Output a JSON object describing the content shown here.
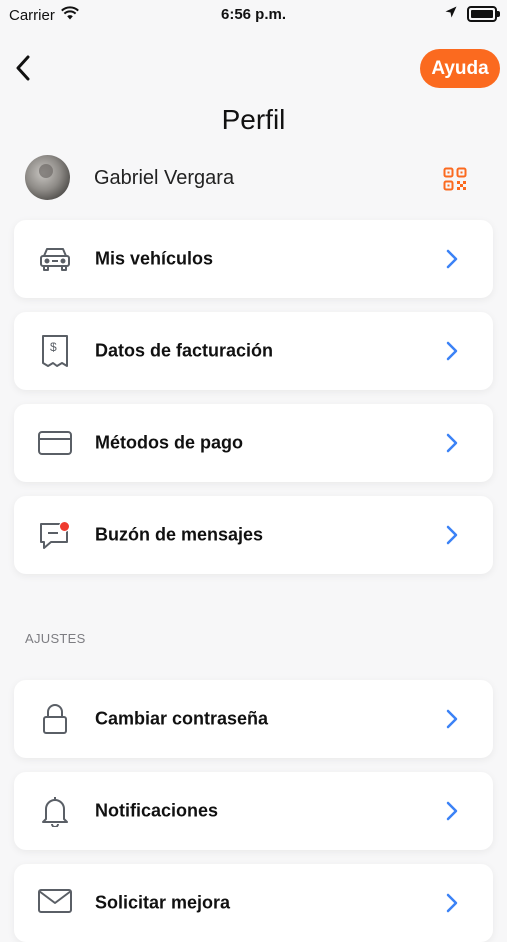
{
  "status_bar": {
    "carrier": "Carrier",
    "time": "6:56 p.m."
  },
  "header": {
    "help_label": "Ayuda",
    "title": "Perfil"
  },
  "profile": {
    "name": "Gabriel Vergara"
  },
  "menu": [
    {
      "label": "Mis vehículos",
      "icon": "car-icon"
    },
    {
      "label": "Datos de facturación",
      "icon": "receipt-icon"
    },
    {
      "label": "Métodos de pago",
      "icon": "credit-card-icon"
    },
    {
      "label": "Buzón de mensajes",
      "icon": "message-icon",
      "has_unread_badge": true
    }
  ],
  "settings": {
    "title": "AJUSTES",
    "items": [
      {
        "label": "Cambiar contraseña",
        "icon": "lock-icon"
      },
      {
        "label": "Notificaciones",
        "icon": "bell-icon"
      },
      {
        "label": "Solicitar mejora",
        "icon": "mail-icon"
      }
    ]
  },
  "colors": {
    "accent": "#fb6a1f",
    "chevron": "#3b82f6",
    "badge": "#ef3a2e",
    "icon": "#5a5f66"
  }
}
